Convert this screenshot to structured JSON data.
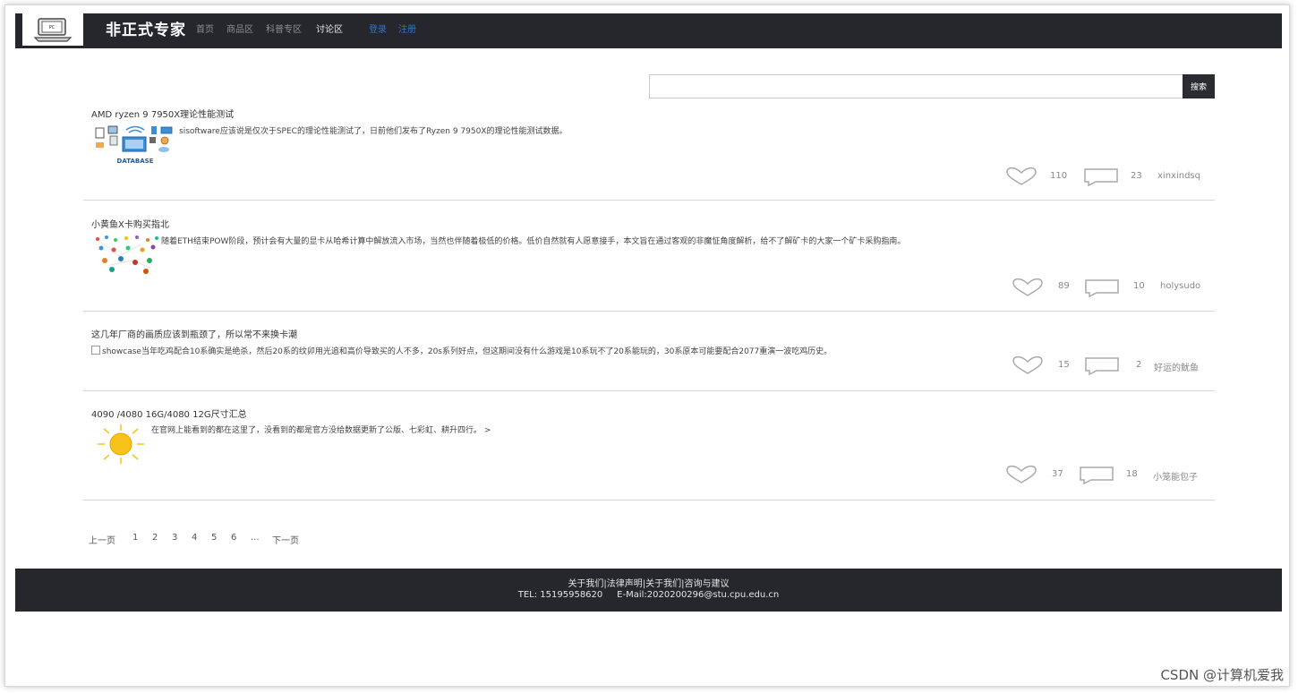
{
  "navbar": {
    "brand": "非正式专家",
    "links": [
      "首页",
      "商品区",
      "科普专区",
      "讨论区"
    ],
    "auth": [
      "登录",
      "注册"
    ]
  },
  "search": {
    "placeholder": "",
    "button_label": "搜索"
  },
  "posts": [
    {
      "title": "AMD ryzen 9 7950X理论性能测试",
      "summary": "sisoftware应该说是仅次于SPEC的理论性能测试了，日前他们发布了Ryzen 9 7950X的理论性能测试数据。",
      "likes": "110",
      "comments": "23",
      "author": "xinxindsq",
      "thumb_caption": "DATABASE"
    },
    {
      "title": "小黄鱼X卡购买指北",
      "summary": "随着ETH结束POW阶段，预计会有大量的显卡从哈希计算中解放流入市场，当然也伴随着极低的价格。低价自然就有人愿意接手，本文旨在通过客观的非魔怔角度解析，给不了解矿卡的大家一个矿卡采购指南。",
      "likes": "89",
      "comments": "10",
      "author": "holysudo"
    },
    {
      "title": "这几年厂商的画质应该到瓶颈了，所以常不来换卡潮",
      "summary": "showcase当年吃鸡配合10系确实是绝杀，然后20系的纹卯用光追和高价导致买的人不多，20s系列好点，但这期间没有什么游戏是10系玩不了20系能玩的，30系原本可能要配合2077重演一波吃鸡历史。",
      "likes": "15",
      "comments": "2",
      "author": "好运的鱿鱼"
    },
    {
      "title": "4090 /4080 16G/4080 12G尺寸汇总",
      "summary": "在官网上能看到的都在这里了，没看到的都是官方没给数据更新了公版、七彩虹、耕升四行。 >",
      "likes": "37",
      "comments": "18",
      "author": "小笼能包子"
    }
  ],
  "pagination": {
    "prev": "上一页",
    "pages": [
      "1",
      "2",
      "3",
      "4",
      "5",
      "6"
    ],
    "ellipsis": "...",
    "next": "下一页"
  },
  "footer": {
    "links": "关于我们|法律声明|关于我们|咨询与建议",
    "contact": "TEL: 15195958620     E-Mail:2020200296@stu.cpu.edu.cn"
  },
  "watermark": "CSDN @计算机爱我"
}
